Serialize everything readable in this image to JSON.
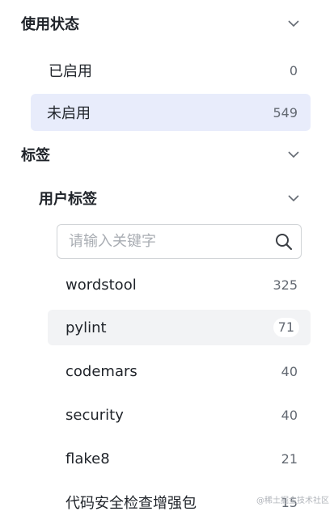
{
  "usage_status": {
    "title": "使用状态",
    "items": [
      {
        "label": "已启用",
        "count": "0"
      },
      {
        "label": "未启用",
        "count": "549"
      }
    ]
  },
  "tags": {
    "title": "标签",
    "user_tags": {
      "title": "用户标签",
      "search_placeholder": "请输入关键字",
      "items": [
        {
          "label": "wordstool",
          "count": "325"
        },
        {
          "label": "pylint",
          "count": "71"
        },
        {
          "label": "codemars",
          "count": "40"
        },
        {
          "label": "security",
          "count": "40"
        },
        {
          "label": "flake8",
          "count": "21"
        },
        {
          "label": "代码安全检查增强包",
          "count": "15"
        }
      ]
    }
  },
  "watermark": "@稀土掘金技术社区",
  "icons": {
    "collapse": "chevron-down-icon",
    "search": "search-icon"
  }
}
